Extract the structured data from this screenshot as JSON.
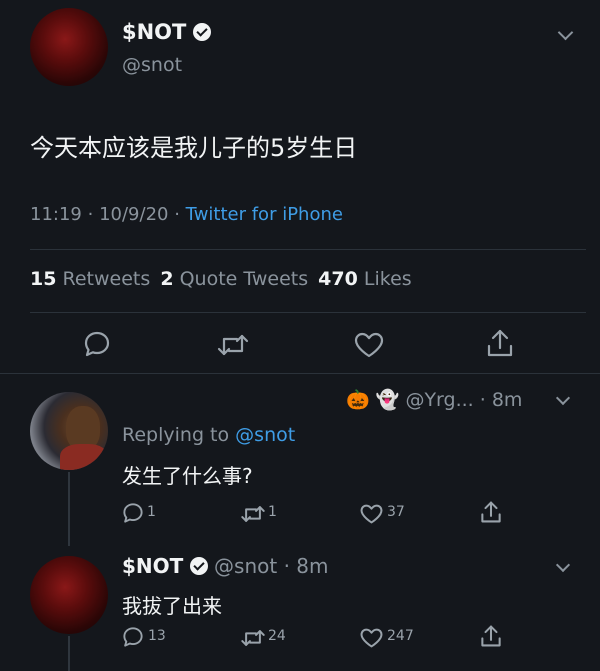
{
  "main_tweet": {
    "display_name": "$NOT",
    "handle": "@snot",
    "text": "今天本应该是我儿子的5岁生日",
    "time": "11:19",
    "date": "10/9/20",
    "separator": "·",
    "source": "Twitter for iPhone",
    "stats": {
      "retweets_count": "15",
      "retweets_label": "Retweets",
      "quotes_count": "2",
      "quotes_label": "Quote Tweets",
      "likes_count": "470",
      "likes_label": "Likes"
    }
  },
  "reply_1": {
    "emoji_pumpkin": "🎃",
    "emoji_ghost": "👻",
    "handle": "@Yrg...",
    "time": "· 8m",
    "replying_label": "Replying to",
    "replying_handle": "@snot",
    "text": "发生了什么事?",
    "reply_count": "1",
    "retweet_count": "1",
    "like_count": "37"
  },
  "reply_2": {
    "display_name": "$NOT",
    "handle": "@snot",
    "time": "· 8m",
    "text": "我拔了出来",
    "reply_count": "13",
    "retweet_count": "24",
    "like_count": "247"
  },
  "colors": {
    "background": "#14171c",
    "link": "#3f9de6",
    "muted": "#8a939c",
    "text": "#e9ecef"
  }
}
